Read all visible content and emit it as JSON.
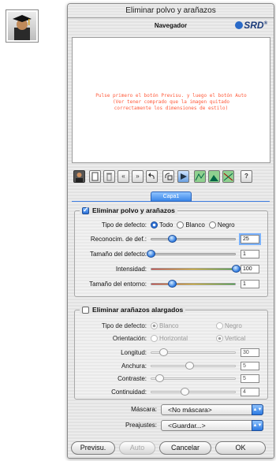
{
  "window": {
    "title": "Eliminar polvo y arañazos"
  },
  "navigator": {
    "title": "Navegador",
    "logo": "SRD",
    "logo_suffix": "®",
    "message_line1": "Pulse primero el botón Previsu. y luego el botón Auto",
    "message_line2": "(Ver tener comprado que la imagen quitado",
    "message_line3": "correctamente los dimensiones de estilo)"
  },
  "toolbar": {
    "icons": [
      "app-icon",
      "page-icon",
      "trash-icon",
      "rewind-icon",
      "forward-icon",
      "undo-icon",
      "redo-icon",
      "preview-icon",
      "histogram-icon",
      "curve-icon",
      "compare-icon",
      "help-icon"
    ],
    "help_label": "?",
    "rewind_label": "«",
    "forward_label": "»"
  },
  "tabs": [
    {
      "label": "Capa1",
      "active": true
    }
  ],
  "dust": {
    "label": "Eliminar polvo y arañazos",
    "checked": true,
    "defect_type_label": "Tipo de defecto:",
    "defect_options": [
      "Todo",
      "Blanco",
      "Negro"
    ],
    "defect_selected": "Todo",
    "recognition": {
      "label": "Reconocim. de def.:",
      "value": "25",
      "level": 0.25
    },
    "defect_size": {
      "label": "Tamaño del defecto:",
      "value": "1",
      "level": 0.0
    },
    "intensity": {
      "label": "Intensidad:",
      "value": "100",
      "level": 1.0
    },
    "surround_size": {
      "label": "Tamaño del entorno:",
      "value": "1",
      "level": 0.25
    }
  },
  "scratches": {
    "label": "Eliminar arañazos alargados",
    "checked": false,
    "defect_type_label": "Tipo de defecto:",
    "defect_options": [
      "Blanco",
      "Negro"
    ],
    "defect_selected": "Blanco",
    "orientation_label": "Orientación:",
    "orientation_options": [
      "Horizontal",
      "Vertical"
    ],
    "orientation_selected": "Vertical",
    "length": {
      "label": "Longitud:",
      "value": "30",
      "level": 0.15
    },
    "width": {
      "label": "Anchura:",
      "value": "5",
      "level": 0.45
    },
    "contrast": {
      "label": "Contraste:",
      "value": "5",
      "level": 0.1
    },
    "continuity": {
      "label": "Continuidad:",
      "value": "4",
      "level": 0.4
    }
  },
  "mask": {
    "label": "Máscara:",
    "value": "<No máscara>"
  },
  "presets": {
    "label": "Preajustes:",
    "value": "<Guardar...>"
  },
  "buttons": {
    "preview": "Previsu.",
    "auto": "Auto",
    "cancel": "Cancelar",
    "ok": "OK"
  },
  "colors": {
    "accent": "#2b78e0",
    "message": "#ff5a3a"
  }
}
